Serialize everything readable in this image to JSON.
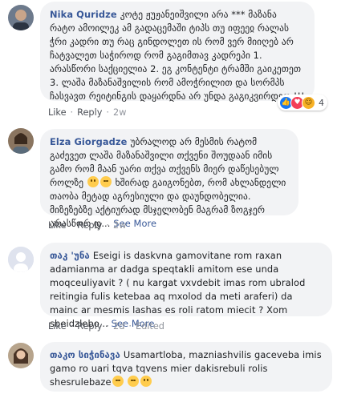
{
  "comments": [
    {
      "author": "Nika Quridze",
      "text": "კოტე ჟუჟანეიშვილი არა *** მაზანა რატო ამოილეკ ამ გადაცემაში ტიპს თუ იფეეჲ რალას ჭრი კადრი თუ რაც გინდოლეთ ის რომ ვერ მიიღებ არ ჩატვალეთ საჭიროდ რომ გაგიმთავ კადრეპი 1. არასწორი საქციელია 2. ეგ კონტენტი ტრამში გაიკეთეთ 3. ლაშა მაზანაშვილის რომ ამოჭრილით და სორმპს ჩასვავთ რეიტინგის დაყარდნა არ უნდა გაგიკვირდეთ !!!",
      "like": "Like",
      "reply": "Reply",
      "time": "2w",
      "reaction_count": "4"
    },
    {
      "author": "Elza Giorgadze",
      "text": "უბრალოდ არ მესმის რატომ გაძევეთ ლაშა მაზანაშვილი თქვენი შოუდაან იმის გამო რომ მაან უარი თქვა თქვენს მიერ დაწესებულ როლზე",
      "text2": "ხშირად გაიგონებთ, რომ ახლანდელი თაობა მეტად აგრესიული და დაუნდობელია. მიზეზებზე აქტიურად მსჯელობენ მაგრამ ზოგჯერ არასწორ დ...",
      "see_more": "See More",
      "like": "Like",
      "reply": "Reply",
      "time": "2w"
    },
    {
      "author": "თაკ 'უნა",
      "text": "Eseigi is daskvna gamovitane rom raxan adamianma ar dadga speqtakli amitom ese unda moqceuliyavit ? ( nu kargat vxvdebit imas rom ubralod reitingia fulis ketebaa aq mxolod da meti araferi) da mainc ar mesmis lashas es roli ratom miecit ? Xom sheidzlebo...",
      "see_more": "See More",
      "like": "Like",
      "reply": "Reply",
      "time": "2d",
      "edited": "Edited"
    },
    {
      "author": "თაკო სიჭინავა",
      "text": "Usamartloba, mazniashvilis gaceveba imis gamo ro uari tqva tqvens mier dakisrebuli rolis shesrulebaze"
    }
  ],
  "colors": {
    "link": "#385898",
    "bubble": "#f2f3f5",
    "meta": "#90949c"
  }
}
